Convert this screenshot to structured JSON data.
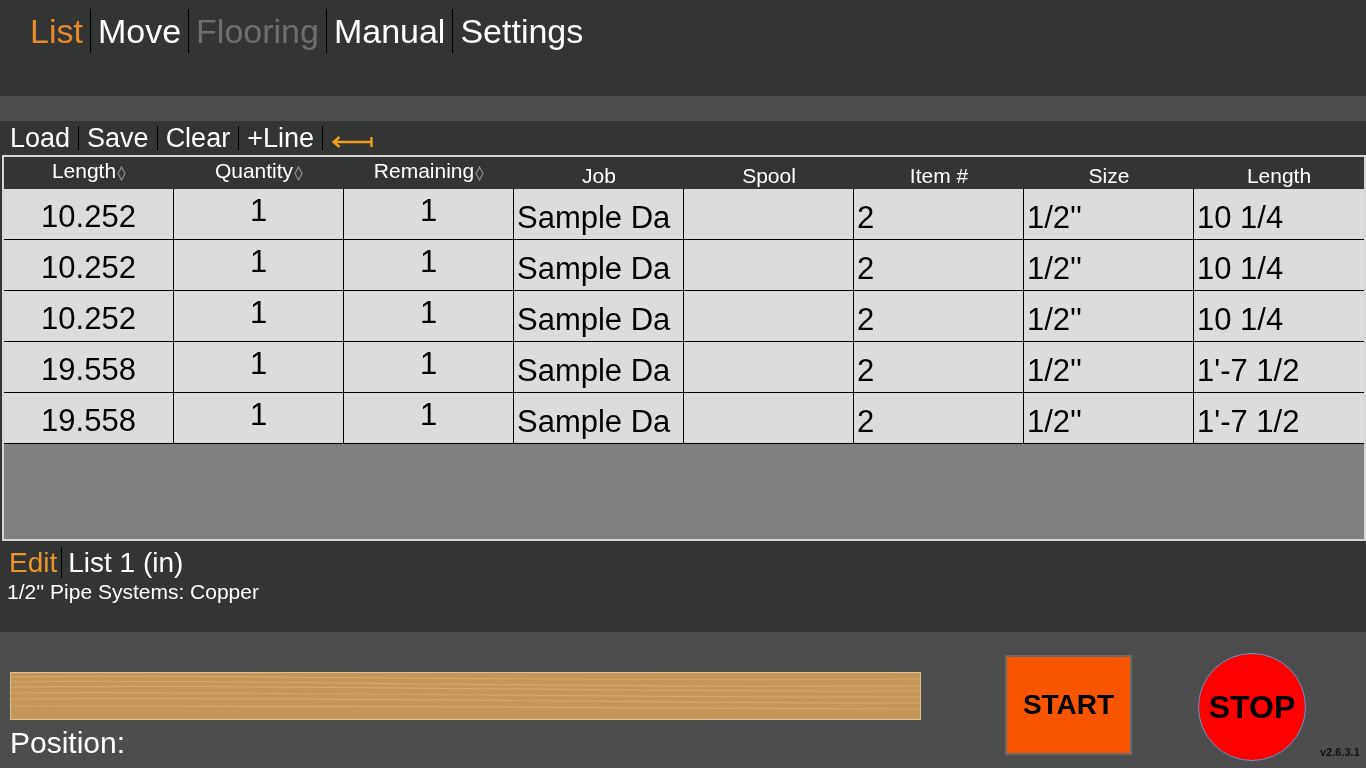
{
  "tabs": [
    {
      "label": "List",
      "selected": true,
      "disabled": false
    },
    {
      "label": "Move",
      "selected": false,
      "disabled": false
    },
    {
      "label": "Flooring",
      "selected": false,
      "disabled": true
    },
    {
      "label": "Manual",
      "selected": false,
      "disabled": false
    },
    {
      "label": "Settings",
      "selected": false,
      "disabled": false
    }
  ],
  "toolbar": {
    "buttons": [
      "Load",
      "Save",
      "Clear",
      "+Line"
    ]
  },
  "table": {
    "columns": [
      {
        "label": "Length",
        "sortable": true
      },
      {
        "label": "Quantity",
        "sortable": true
      },
      {
        "label": "Remaining",
        "sortable": true
      },
      {
        "label": "Job",
        "sortable": false
      },
      {
        "label": "Spool",
        "sortable": false
      },
      {
        "label": "Item #",
        "sortable": false
      },
      {
        "label": "Size",
        "sortable": false
      },
      {
        "label": "Length",
        "sortable": false
      }
    ],
    "rows": [
      {
        "length_decimal": "10.252",
        "quantity": "1",
        "remaining": "1",
        "job": "Sample Da",
        "item_number": "2",
        "size": "1/2''",
        "length": "10 1/4"
      },
      {
        "length_decimal": "10.252",
        "quantity": "1",
        "remaining": "1",
        "job": "Sample Da",
        "item_number": "2",
        "size": "1/2''",
        "length": "10 1/4"
      },
      {
        "length_decimal": "10.252",
        "quantity": "1",
        "remaining": "1",
        "job": "Sample Da",
        "item_number": "2",
        "size": "1/2''",
        "length": "10 1/4"
      },
      {
        "length_decimal": "19.558",
        "quantity": "1",
        "remaining": "1",
        "job": "Sample Da",
        "item_number": "2",
        "size": "1/2''",
        "length": "1'-7 1/2"
      },
      {
        "length_decimal": "19.558",
        "quantity": "1",
        "remaining": "1",
        "job": "Sample Da",
        "item_number": "2",
        "size": "1/2''",
        "length": "1'-7 1/2"
      }
    ]
  },
  "list_info": {
    "mode_button": "Edit",
    "list_name": "List 1 (in)",
    "description": "1/2'' Pipe Systems: Copper"
  },
  "machine": {
    "position_label": "Position:",
    "start_button": "START",
    "stop_button": "STOP",
    "version": "v2.6.3.1"
  }
}
